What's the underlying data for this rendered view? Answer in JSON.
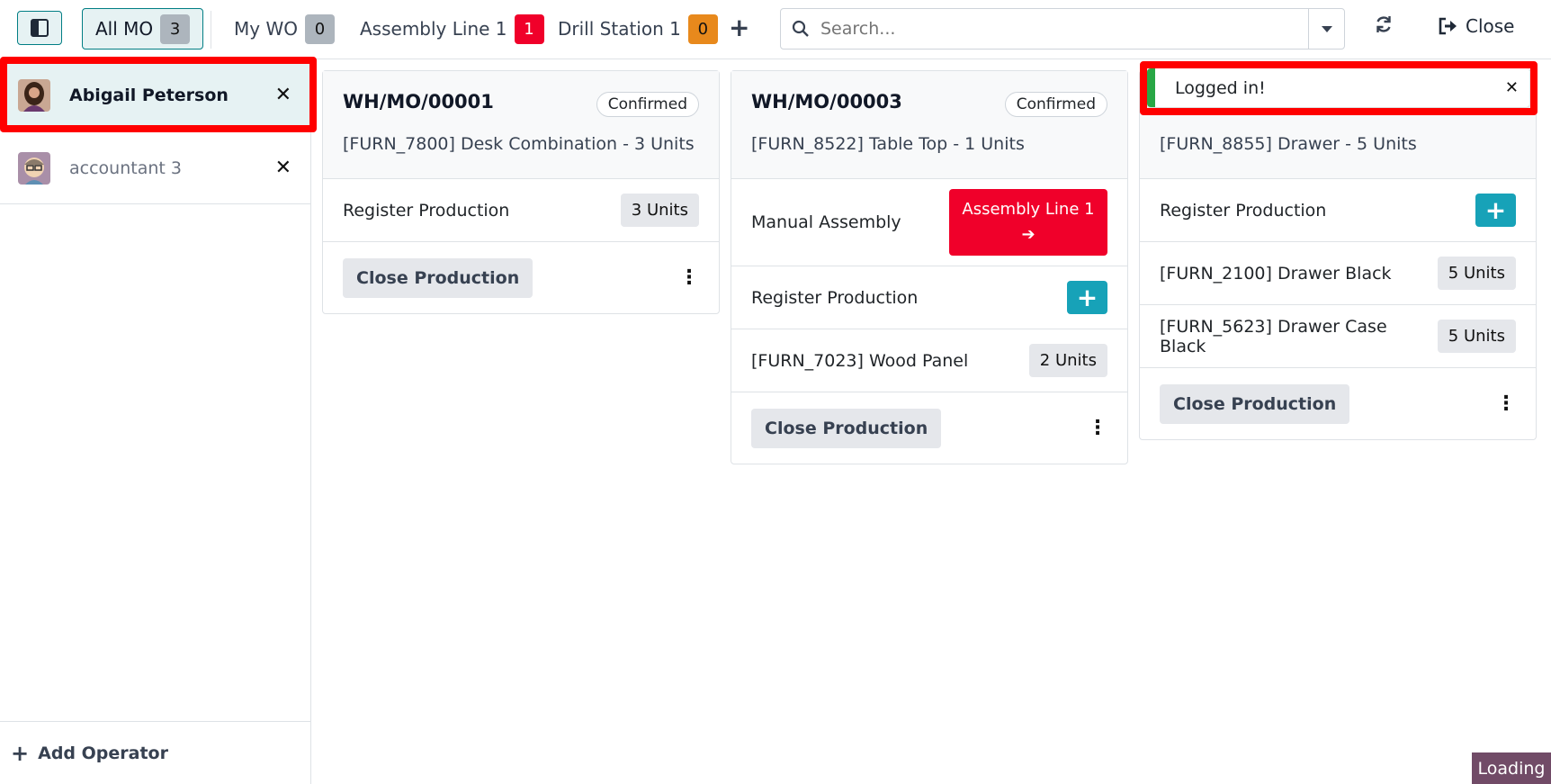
{
  "topbar": {
    "tabs": [
      {
        "label": "All MO",
        "count": "3"
      },
      {
        "label": "My WO",
        "count": "0"
      },
      {
        "label": "Assembly Line 1",
        "count": "1"
      },
      {
        "label": "Drill Station 1",
        "count": "0"
      }
    ],
    "search_placeholder": "Search...",
    "close_label": "Close"
  },
  "operators": [
    {
      "name": "Abigail Peterson",
      "selected": true
    },
    {
      "name": "accountant 3",
      "selected": false
    }
  ],
  "add_operator_label": "Add Operator",
  "cards": [
    {
      "mo": "WH/MO/00001",
      "status": "Confirmed",
      "product": "[FURN_7800] Desk Combination - 3 Units",
      "register_label": "Register Production",
      "register_units": "3 Units",
      "close_label": "Close Production"
    },
    {
      "mo": "WH/MO/00003",
      "status": "Confirmed",
      "product": "[FURN_8522] Table Top - 1 Units",
      "step_label": "Manual Assembly",
      "workcenter_button": "Assembly Line 1",
      "register_label": "Register Production",
      "component_label": "[FURN_7023] Wood Panel",
      "component_units": "2 Units",
      "close_label": "Close Production"
    },
    {
      "product": "[FURN_8855] Drawer - 5 Units",
      "register_label": "Register Production",
      "components": [
        {
          "label": "[FURN_2100] Drawer Black",
          "units": "5 Units"
        },
        {
          "label": "[FURN_5623] Drawer Case Black",
          "units": "5 Units"
        }
      ],
      "close_label": "Close Production"
    }
  ],
  "toast": {
    "message": "Logged in!"
  },
  "loading_label": "Loading",
  "colors": {
    "accent": "#017e84",
    "danger": "#f0002a",
    "info": "#17a2b8",
    "warning": "#e8891c",
    "success": "#28a745"
  }
}
